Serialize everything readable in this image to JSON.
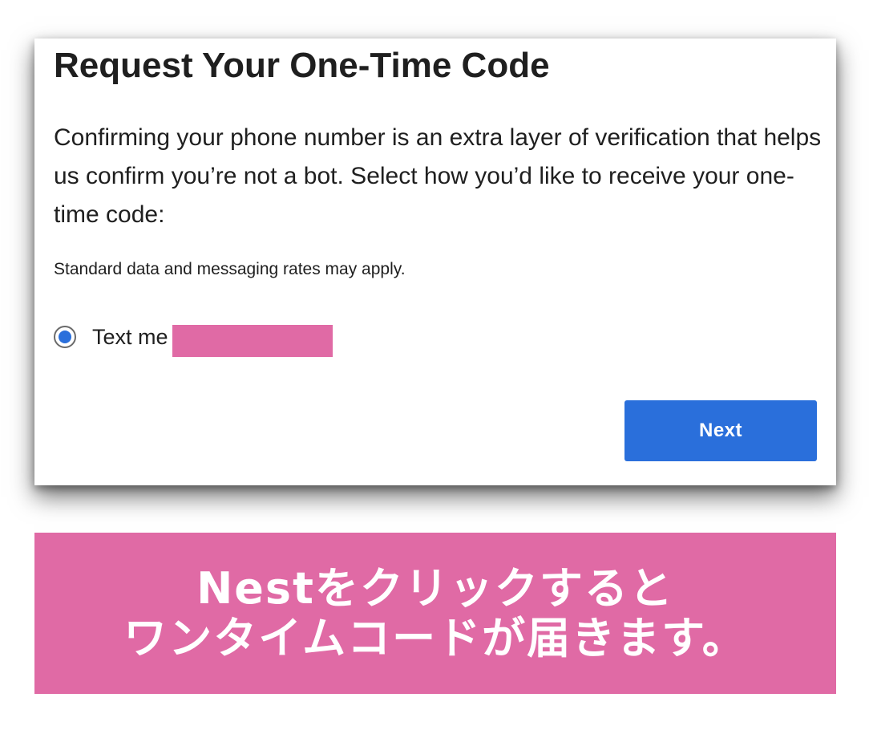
{
  "dialog": {
    "title": "Request Your One-Time Code",
    "description": "Confirming your phone number is an extra layer of verification that helps us confirm you’re not a bot. Select how you’d like to receive your one-time code:",
    "rates_note": "Standard data and messaging rates may apply.",
    "option": {
      "label": "Text me",
      "selected": true
    },
    "next_label": "Next"
  },
  "banner": {
    "line1": "Nestをクリックすると",
    "line2": "ワンタイムコードが届きます。"
  },
  "colors": {
    "accent_blue": "#2a6fdb",
    "banner_pink": "#e06aa5",
    "redaction_pink": "#e06aa5",
    "text_dark": "#1f1f1f"
  }
}
